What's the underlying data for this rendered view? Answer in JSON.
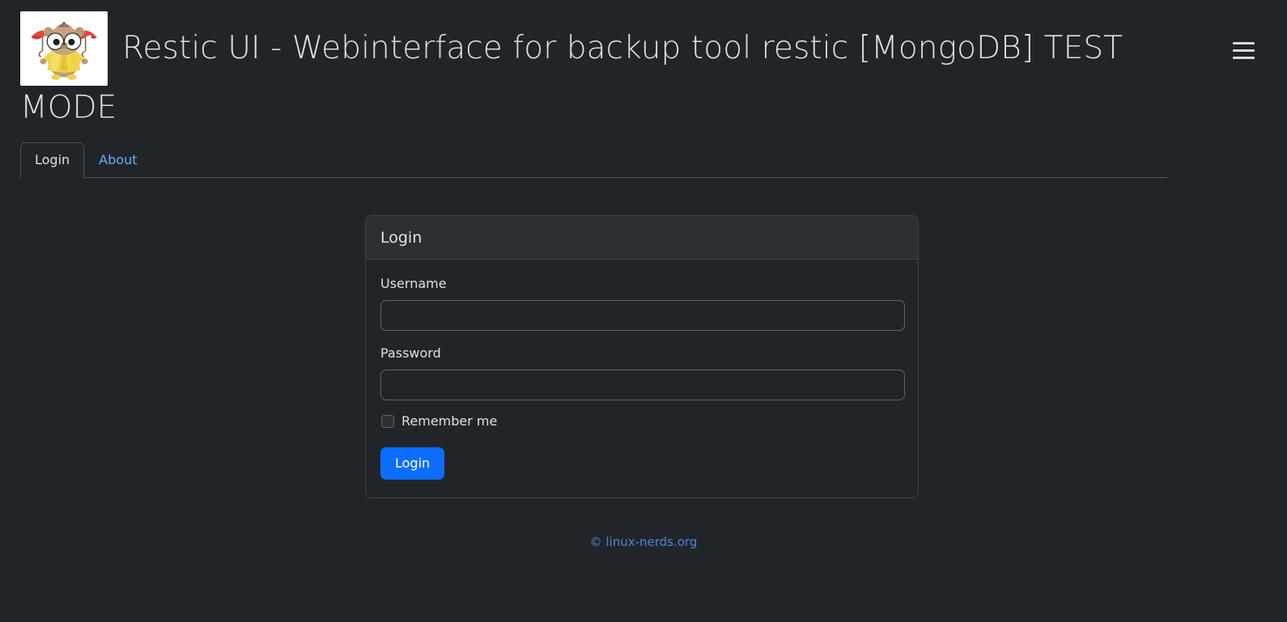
{
  "header": {
    "logo_alt": "restic-gopher-logo",
    "title": "Restic UI - Webinterface for backup tool restic [MongoDB] TEST MODE",
    "menu_icon": "hamburger-menu-icon"
  },
  "tabs": [
    {
      "label": "Login",
      "active": true
    },
    {
      "label": "About",
      "active": false
    }
  ],
  "login_card": {
    "header_title": "Login",
    "username": {
      "label": "Username",
      "value": "",
      "placeholder": ""
    },
    "password": {
      "label": "Password",
      "value": "",
      "placeholder": ""
    },
    "remember": {
      "label": "Remember me",
      "checked": false
    },
    "submit_label": "Login"
  },
  "footer": {
    "copyright": "© linux-nerds.org"
  },
  "colors": {
    "page_background": "#212529",
    "card_header_background": "#2b3035",
    "border": "#3b4248",
    "tab_border": "#495057",
    "text": "#dee2e6",
    "link": "#6ea8fe",
    "footer_link": "#4f86d6",
    "primary_button": "#0d6efd"
  }
}
